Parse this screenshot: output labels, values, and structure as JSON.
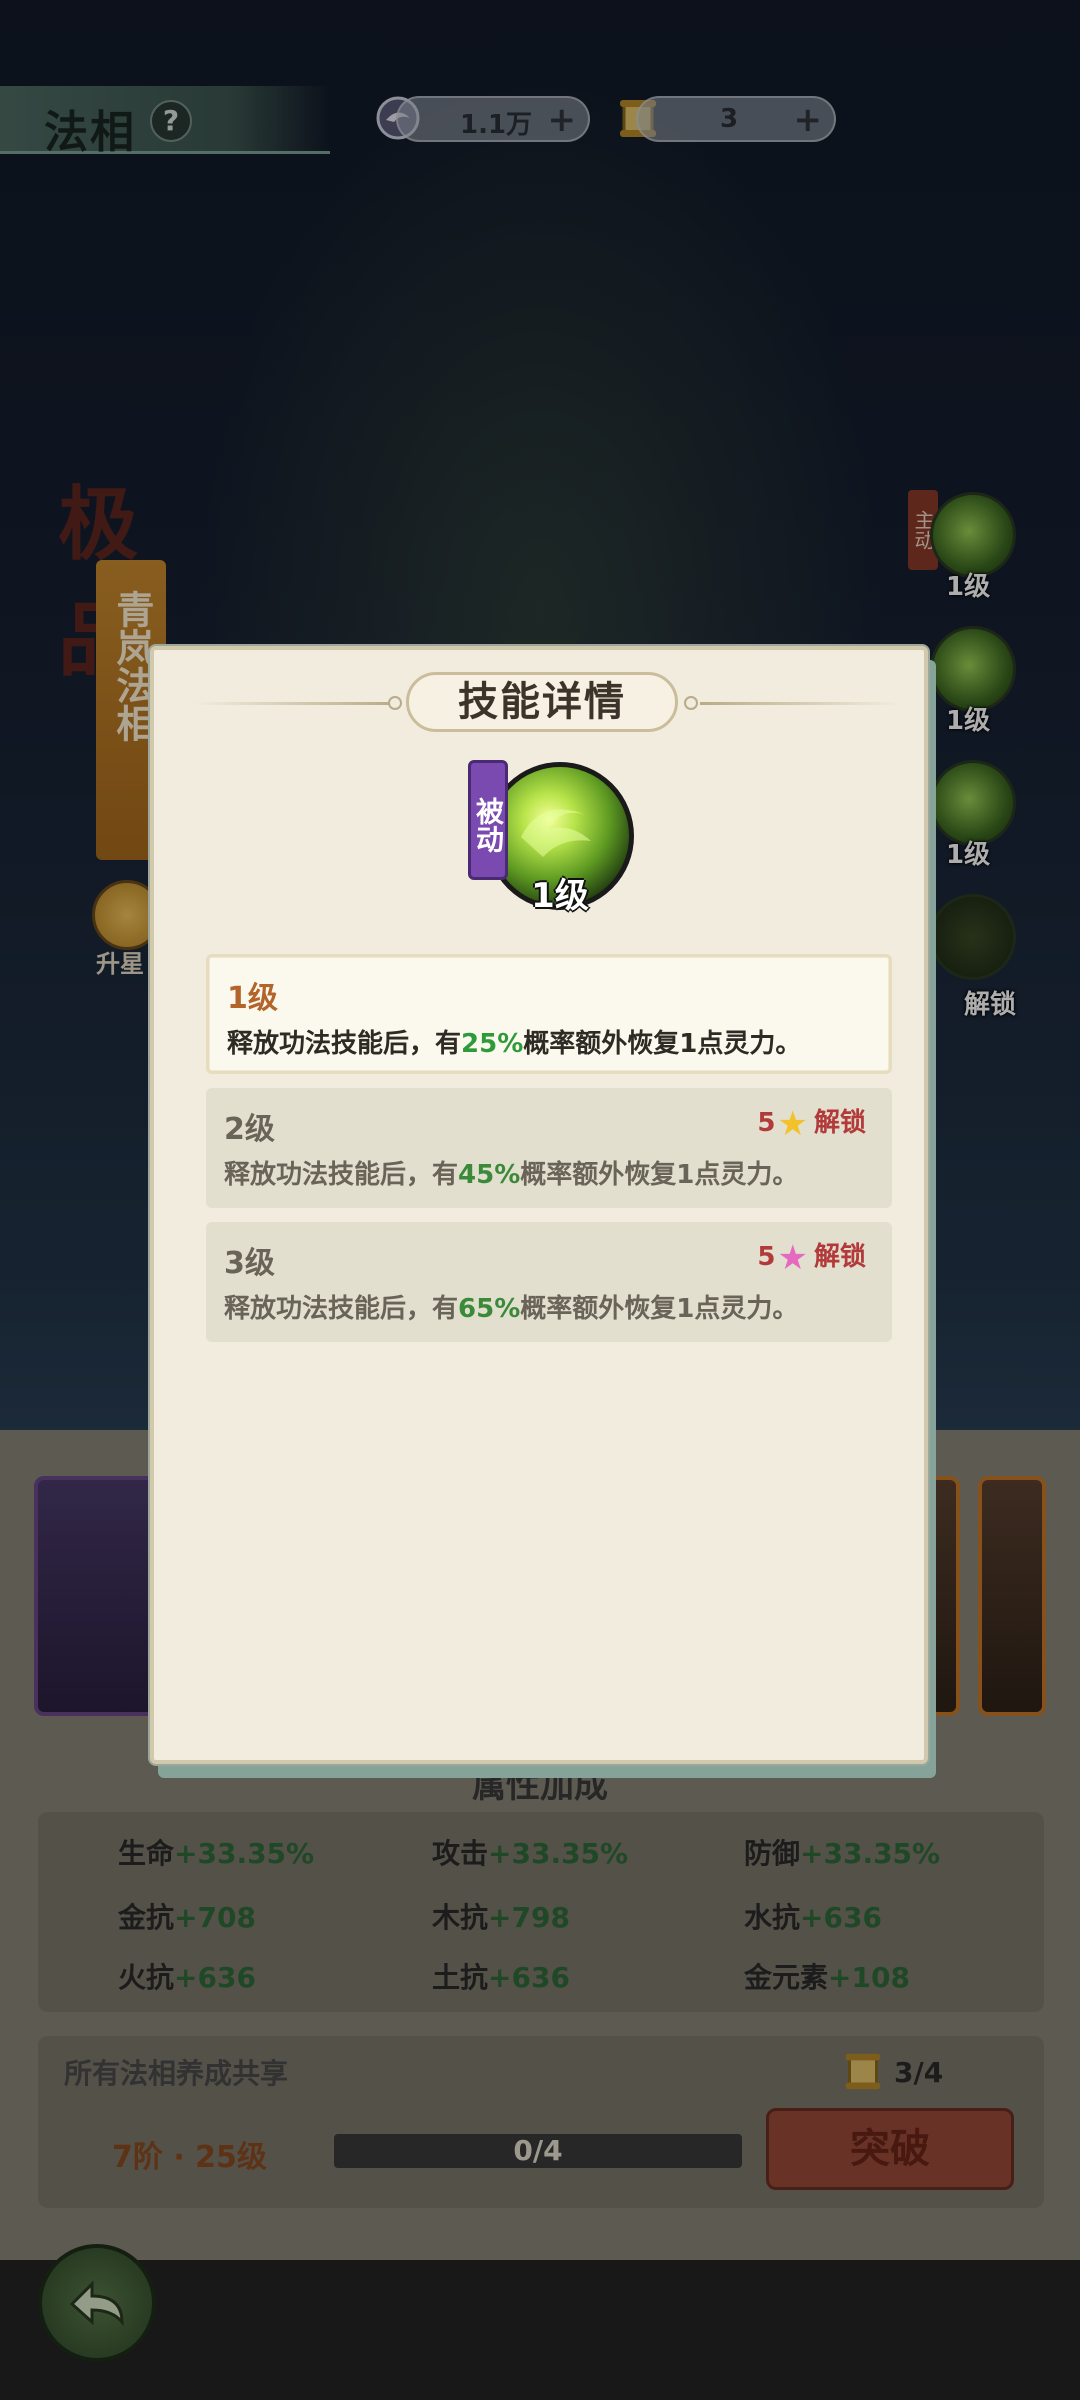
{
  "header": {
    "title": "法相",
    "help_glyph": "?",
    "resources": [
      {
        "name": "spirit-orb",
        "value": "1.1万"
      },
      {
        "name": "scroll",
        "value": "3"
      }
    ]
  },
  "side": {
    "grade": "极品",
    "fahsiang_name": "青岚法相",
    "upstar_label": "升星"
  },
  "skill_list": [
    {
      "tag": "主动",
      "label": "1级"
    },
    {
      "label": "1级"
    },
    {
      "label": "1级"
    },
    {
      "label": "解锁"
    }
  ],
  "dialog": {
    "title": "技能详情",
    "skill_type": "被动",
    "skill_level": "1级",
    "levels": [
      {
        "name": "1级",
        "desc_before": "释放功法技能后，有",
        "pct": "25%",
        "desc_after": "概率额外恢复1点灵力。",
        "unlock": ""
      },
      {
        "name": "2级",
        "desc_before": "释放功法技能后，有",
        "pct": "45%",
        "desc_after": "概率额外恢复1点灵力。",
        "unlock": "5",
        "unlock_text": "解锁",
        "star_color": "#f2c22a"
      },
      {
        "name": "3级",
        "desc_before": "释放功法技能后，有",
        "pct": "65%",
        "desc_after": "概率额外恢复1点灵力。",
        "unlock": "5",
        "unlock_text": "解锁",
        "star_color": "#e46ac0"
      }
    ]
  },
  "attributes": {
    "header": "属性加成",
    "items": [
      {
        "name": "生命",
        "value": "+33.35%"
      },
      {
        "name": "攻击",
        "value": "+33.35%"
      },
      {
        "name": "防御",
        "value": "+33.35%"
      },
      {
        "name": "金抗",
        "value": "+708"
      },
      {
        "name": "木抗",
        "value": "+798"
      },
      {
        "name": "水抗",
        "value": "+636"
      },
      {
        "name": "火抗",
        "value": "+636"
      },
      {
        "name": "土抗",
        "value": "+636"
      },
      {
        "name": "金元素",
        "value": "+108"
      }
    ]
  },
  "shared": {
    "label": "所有法相养成共享",
    "count": "3/4",
    "stage": "7阶 · 25级",
    "progress_text": "0/4",
    "progress_fraction": 0,
    "break_button": "突破"
  },
  "colors": {
    "accent_green": "#2e9a3a",
    "unlock_red": "#b23a3a",
    "passive_purple": "#7a4ab0"
  }
}
